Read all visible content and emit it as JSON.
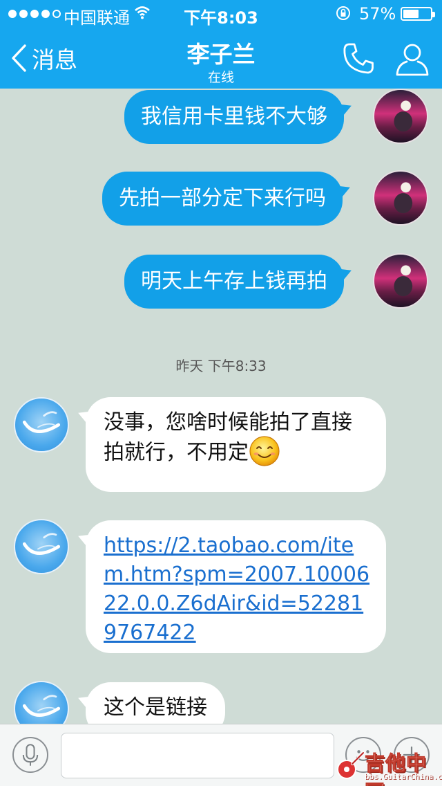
{
  "status_bar": {
    "carrier": "中国联通",
    "time": "下午8:03",
    "battery": "57%",
    "battery_level": 0.57
  },
  "nav": {
    "back_label": "消息",
    "title": "李子兰",
    "subtitle": "在线"
  },
  "messages": [
    {
      "direction": "out",
      "text": "我信用卡里钱不大够"
    },
    {
      "direction": "out",
      "text": "先拍一部分定下来行吗"
    },
    {
      "direction": "out",
      "text": "明天上午存上钱再拍"
    },
    {
      "direction": "in",
      "text": "没事，您啥时候能拍了直接拍就行，不用定"
    },
    {
      "direction": "in",
      "text": "https://2.taobao.com/item.htm?spm=2007.1000622.0.0.Z6dAir&id=522819767422"
    },
    {
      "direction": "in",
      "text": "这个是链接"
    }
  ],
  "timestamp": "昨天 下午8:33",
  "input_bar": {
    "placeholder": ""
  },
  "watermark": {
    "text": "吉他中国",
    "sub": "bbs.GuitarChina.com"
  },
  "colors": {
    "header": "#16a7ef",
    "outgoing_bubble": "#12a0e8",
    "incoming_bubble": "#ffffff",
    "background": "#cfdcd6",
    "link": "#1a6fcf"
  }
}
